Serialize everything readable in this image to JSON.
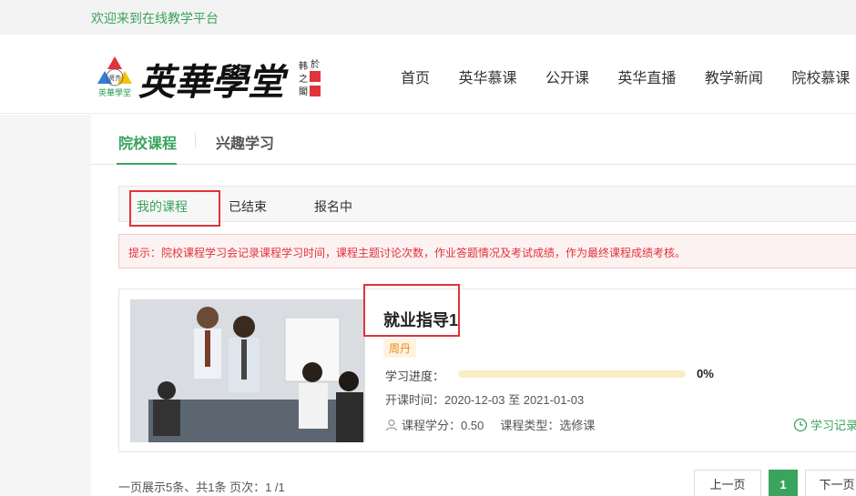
{
  "topbar": {
    "welcome": "欢迎来到在线教学平台"
  },
  "logo": {
    "text": "英華學堂",
    "mark_caption": "英華學堂",
    "mark_inner": "贤齐",
    "colors": {
      "red": "#e0333a",
      "blue": "#2f7fd6",
      "yellow": "#f4c20d"
    }
  },
  "nav": {
    "items": [
      "首页",
      "英华慕课",
      "公开课",
      "英华直播",
      "教学新闻",
      "院校慕课"
    ]
  },
  "tabs_main": {
    "active": "院校课程",
    "other": "兴趣学习"
  },
  "tabs_sub": {
    "items": [
      "我的课程",
      "已结束",
      "报名中"
    ],
    "active_index": 0
  },
  "tip": "提示：院校课程学习会记录课程学习时间，课程主题讨论次数，作业答题情况及考试成绩，作为最终课程成绩考核。",
  "course": {
    "title": "就业指导1",
    "teacher": "周丹",
    "progress_label": "学习进度：",
    "progress_value": "0%",
    "progress_fraction": 0,
    "time_text": "开课时间：2020-12-03 至 2021-01-03",
    "credit_text": "课程学分：0.50",
    "type_text": "课程类型：选修课",
    "record_label": "学习记录"
  },
  "pagination": {
    "info": "一页展示5条、共1条 页次：1 /1",
    "prev": "上一页",
    "current": "1",
    "next": "下一页"
  },
  "colors": {
    "accent": "#3aa35d",
    "highlight": "#e0333a",
    "tip_bg": "#fdf2f2"
  }
}
